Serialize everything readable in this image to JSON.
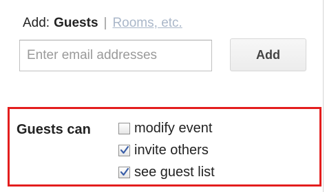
{
  "add_row": {
    "label": "Add:",
    "active_tab": "Guests",
    "separator": "|",
    "inactive_tab": "Rooms, etc."
  },
  "email": {
    "placeholder": "Enter email addresses",
    "value": ""
  },
  "add_button": {
    "label": "Add"
  },
  "permissions": {
    "title": "Guests can",
    "options": [
      {
        "label": "modify event",
        "checked": false
      },
      {
        "label": "invite others",
        "checked": true
      },
      {
        "label": "see guest list",
        "checked": true
      }
    ]
  },
  "colors": {
    "highlight_border": "#e31d1d",
    "link": "#aab7c9",
    "checkmark": "#3b5fa8"
  }
}
